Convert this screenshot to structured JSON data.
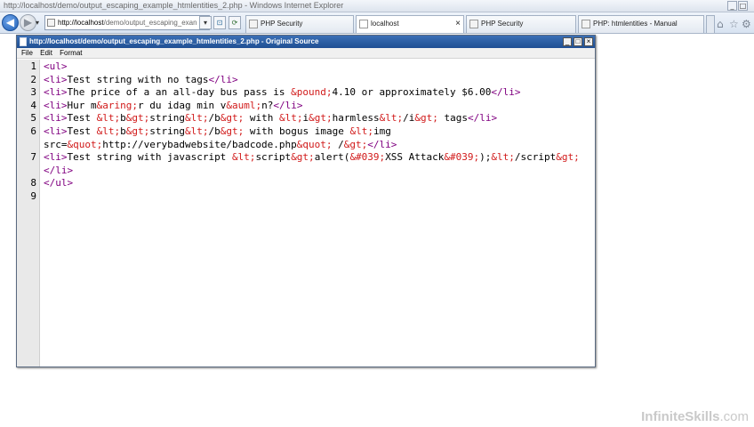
{
  "browser": {
    "window_title": "http://localhost/demo/output_escaping_example_htmlentities_2.php - Windows Internet Explorer",
    "address_domain": "http://localhost",
    "address_path": "/demo/output_escaping_exan",
    "tabs": [
      {
        "label": "PHP Security",
        "active": false
      },
      {
        "label": "localhost",
        "active": true
      },
      {
        "label": "PHP Security",
        "active": false
      },
      {
        "label": "PHP: htmlentities - Manual",
        "active": false
      }
    ],
    "tab_close": "×"
  },
  "source_window": {
    "title": "http://localhost/demo/output_escaping_example_htmlentities_2.php - Original Source",
    "menu": [
      "File",
      "Edit",
      "Format"
    ]
  },
  "code_lines": [
    {
      "n": "1",
      "segments": [
        [
          "tag",
          "<ul>"
        ]
      ]
    },
    {
      "n": "2",
      "segments": [
        [
          "tag",
          "<li>"
        ],
        [
          "plain",
          "Test string with no tags"
        ],
        [
          "tag",
          "</li>"
        ]
      ]
    },
    {
      "n": "3",
      "segments": [
        [
          "tag",
          "<li>"
        ],
        [
          "plain",
          "The price of a an all-day bus pass is "
        ],
        [
          "ent",
          "&pound;"
        ],
        [
          "plain",
          "4.10 or approximately $6.00"
        ],
        [
          "tag",
          "</li>"
        ]
      ]
    },
    {
      "n": "4",
      "segments": [
        [
          "tag",
          "<li>"
        ],
        [
          "plain",
          "Hur m"
        ],
        [
          "ent",
          "&aring;"
        ],
        [
          "plain",
          "r du idag min v"
        ],
        [
          "ent",
          "&auml;"
        ],
        [
          "plain",
          "n?"
        ],
        [
          "tag",
          "</li>"
        ]
      ]
    },
    {
      "n": "5",
      "segments": [
        [
          "tag",
          "<li>"
        ],
        [
          "plain",
          "Test "
        ],
        [
          "ent",
          "&lt;"
        ],
        [
          "plain",
          "b"
        ],
        [
          "ent",
          "&gt;"
        ],
        [
          "plain",
          "string"
        ],
        [
          "ent",
          "&lt;"
        ],
        [
          "plain",
          "/b"
        ],
        [
          "ent",
          "&gt;"
        ],
        [
          "plain",
          " with "
        ],
        [
          "ent",
          "&lt;"
        ],
        [
          "plain",
          "i"
        ],
        [
          "ent",
          "&gt;"
        ],
        [
          "plain",
          "harmless"
        ],
        [
          "ent",
          "&lt;"
        ],
        [
          "plain",
          "/i"
        ],
        [
          "ent",
          "&gt;"
        ],
        [
          "plain",
          " tags"
        ],
        [
          "tag",
          "</li>"
        ]
      ]
    },
    {
      "n": "6",
      "segments": [
        [
          "tag",
          "<li>"
        ],
        [
          "plain",
          "Test "
        ],
        [
          "ent",
          "&lt;"
        ],
        [
          "plain",
          "b"
        ],
        [
          "ent",
          "&gt;"
        ],
        [
          "plain",
          "string"
        ],
        [
          "ent",
          "&lt;"
        ],
        [
          "plain",
          "/b"
        ],
        [
          "ent",
          "&gt;"
        ],
        [
          "plain",
          " with bogus image "
        ],
        [
          "ent",
          "&lt;"
        ],
        [
          "plain",
          "img"
        ]
      ]
    },
    {
      "n": "",
      "segments": [
        [
          "plain",
          "src="
        ],
        [
          "ent",
          "&quot;"
        ],
        [
          "plain",
          "http://verybadwebsite/badcode.php"
        ],
        [
          "ent",
          "&quot;"
        ],
        [
          "plain",
          " /"
        ],
        [
          "ent",
          "&gt;"
        ],
        [
          "tag",
          "</li>"
        ]
      ]
    },
    {
      "n": "7",
      "segments": [
        [
          "tag",
          "<li>"
        ],
        [
          "plain",
          "Test string with javascript "
        ],
        [
          "ent",
          "&lt;"
        ],
        [
          "plain",
          "script"
        ],
        [
          "ent",
          "&gt;"
        ],
        [
          "plain",
          "alert("
        ],
        [
          "ent",
          "&#039;"
        ],
        [
          "plain",
          "XSS Attack"
        ],
        [
          "ent",
          "&#039;"
        ],
        [
          "plain",
          ");"
        ],
        [
          "ent",
          "&lt;"
        ],
        [
          "plain",
          "/script"
        ],
        [
          "ent",
          "&gt;"
        ]
      ]
    },
    {
      "n": "",
      "segments": [
        [
          "tag",
          "</li>"
        ]
      ]
    },
    {
      "n": "8",
      "segments": [
        [
          "tag",
          "</ul>"
        ]
      ]
    },
    {
      "n": "9",
      "segments": []
    }
  ],
  "watermark": {
    "brand": "InfiniteSkills",
    "suffix": ".com"
  }
}
